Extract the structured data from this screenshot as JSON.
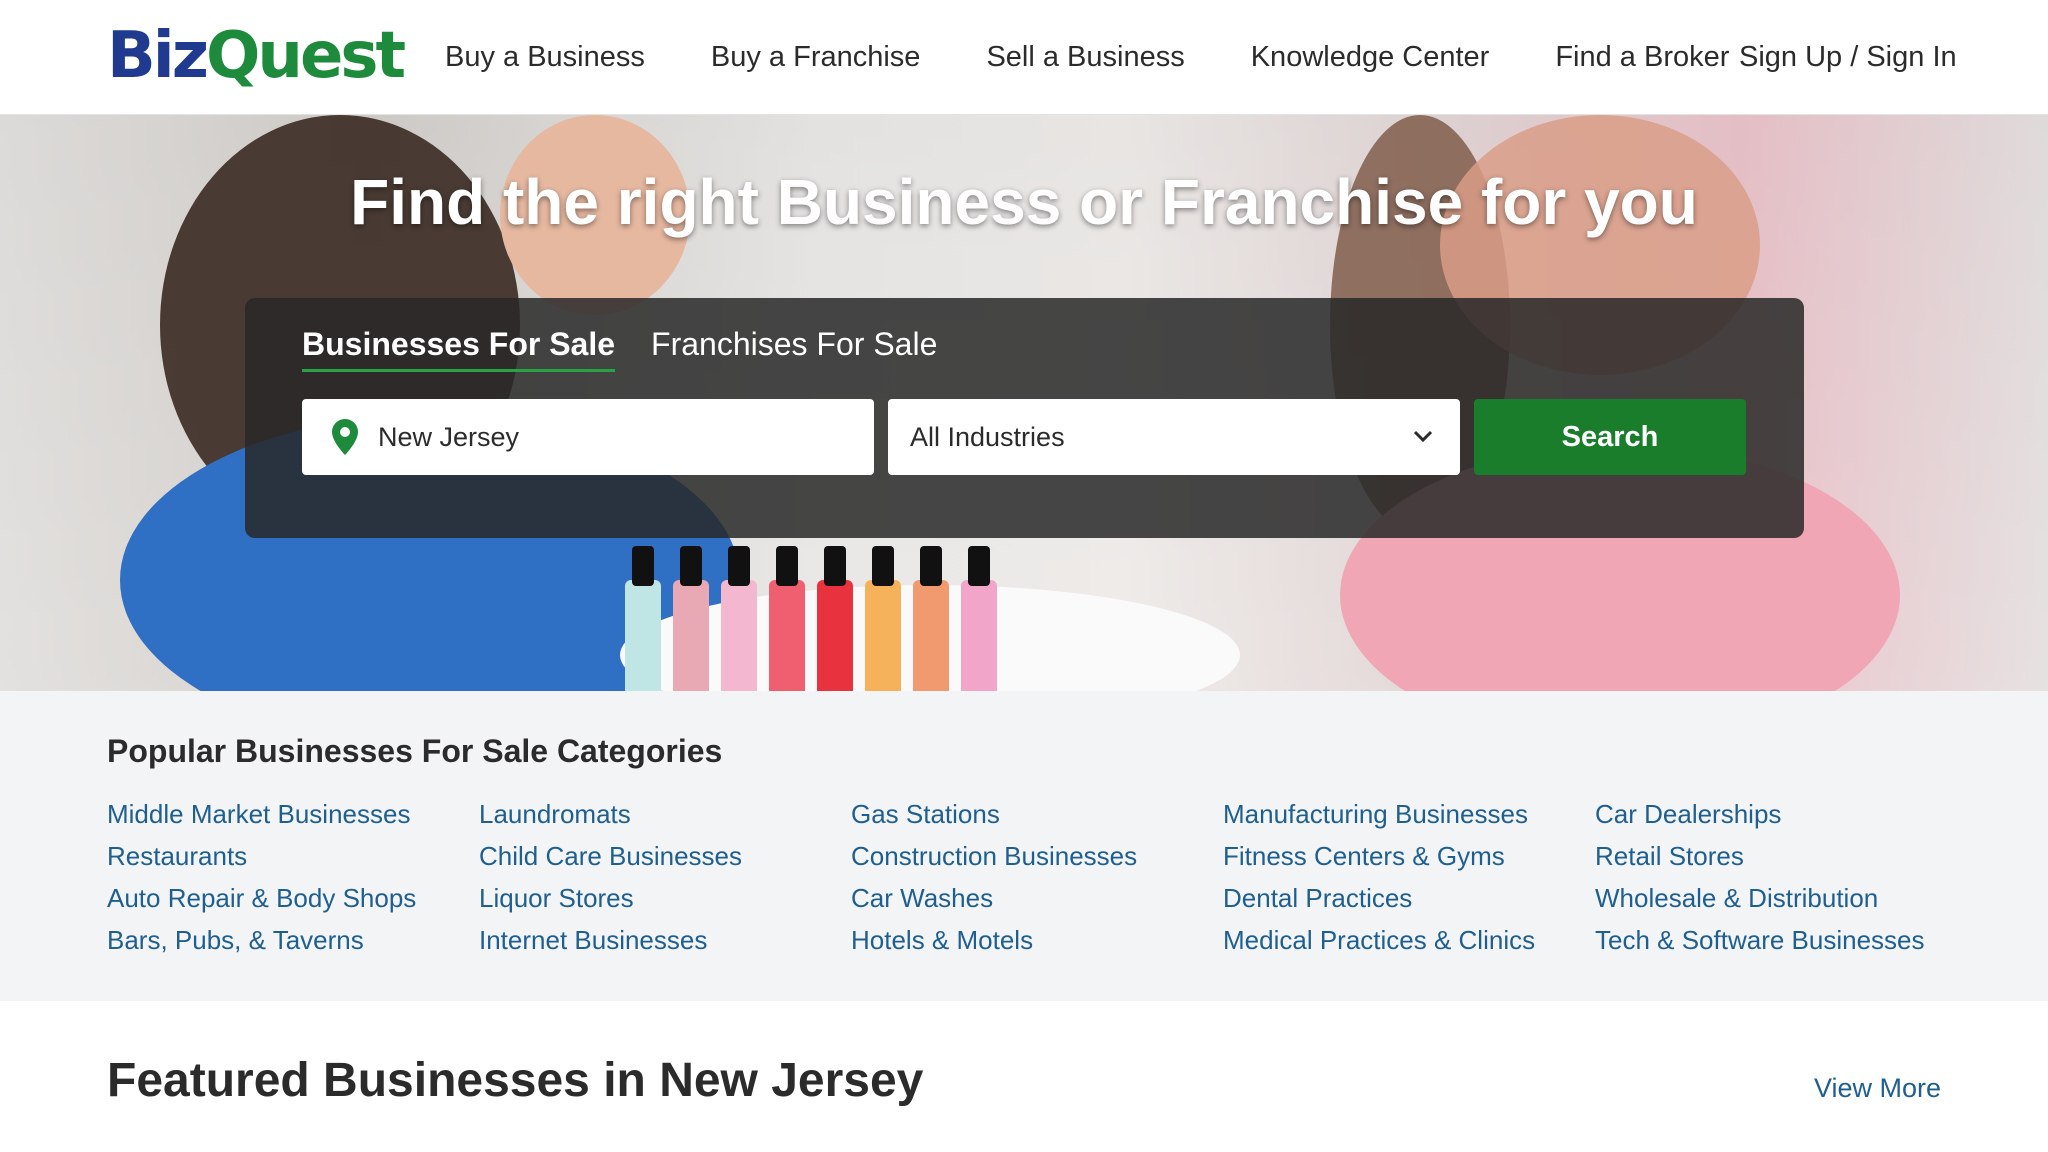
{
  "header": {
    "logo_part1": "Biz",
    "logo_part2": "Quest",
    "nav": [
      "Buy a Business",
      "Buy a Franchise",
      "Sell a Business",
      "Knowledge Center",
      "Find a Broker"
    ],
    "signin": "Sign Up / Sign In"
  },
  "hero": {
    "title": "Find the right Business or Franchise for you",
    "tabs": [
      "Businesses For Sale",
      "Franchises For Sale"
    ],
    "location_value": "New Jersey",
    "industry_value": "All Industries",
    "search_label": "Search"
  },
  "categories": {
    "title": "Popular Businesses For Sale Categories",
    "items": [
      "Middle Market Businesses",
      "Laundromats",
      "Gas Stations",
      "Manufacturing Businesses",
      "Car Dealerships",
      "Restaurants",
      "Child Care Businesses",
      "Construction Businesses",
      "Fitness Centers & Gyms",
      "Retail Stores",
      "Auto Repair & Body Shops",
      "Liquor Stores",
      "Car Washes",
      "Dental Practices",
      "Wholesale & Distribution",
      "Bars, Pubs, & Taverns",
      "Internet Businesses",
      "Hotels & Motels",
      "Medical Practices & Clinics",
      "Tech & Software Businesses"
    ]
  },
  "featured": {
    "title": "Featured Businesses in New Jersey",
    "view_more": "View More"
  },
  "colors": {
    "brand_blue": "#1f3a8f",
    "brand_green": "#1e8a3b",
    "button_green": "#1a7d2c",
    "link_blue": "#1f5f8f"
  }
}
